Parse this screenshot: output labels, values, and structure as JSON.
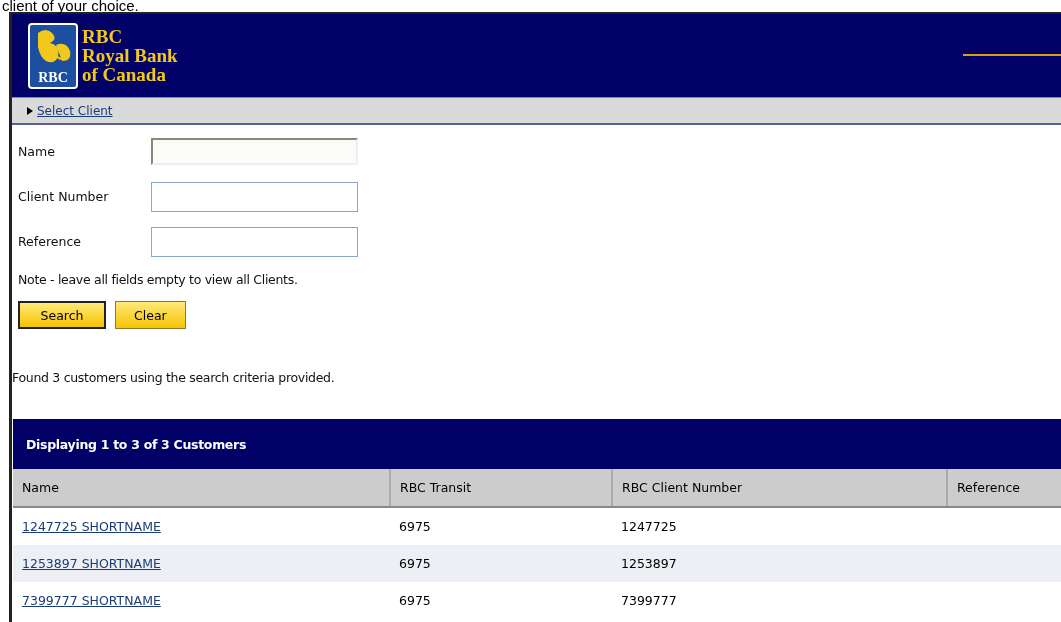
{
  "caption": "client of your choice.",
  "header": {
    "logo_mark": "RBC",
    "brand_lines": [
      "RBC",
      "Royal Bank",
      "of Canada"
    ]
  },
  "breadcrumb": {
    "label": "Select Client"
  },
  "search_form": {
    "fields": [
      {
        "label": "Name",
        "focused": true
      },
      {
        "label": "Client Number",
        "focused": false
      },
      {
        "label": "Reference",
        "focused": false
      }
    ],
    "note": "Note - leave all fields empty to view all Clients.",
    "buttons": [
      {
        "label": "Search",
        "default": true
      },
      {
        "label": "Clear",
        "default": false
      }
    ]
  },
  "result_message": "Found 3 customers using the search criteria provided.",
  "table": {
    "title": "Displaying 1 to 3 of 3 Customers",
    "columns": [
      "Name",
      "RBC Transit",
      "RBC Client Number",
      "Reference"
    ],
    "rows": [
      {
        "name": "1247725 SHORTNAME",
        "transit": "6975",
        "client_number": "1247725"
      },
      {
        "name": "1253897 SHORTNAME",
        "transit": "6975",
        "client_number": "1253897"
      },
      {
        "name": "7399777 SHORTNAME",
        "transit": "6975",
        "client_number": "7399777"
      }
    ]
  }
}
